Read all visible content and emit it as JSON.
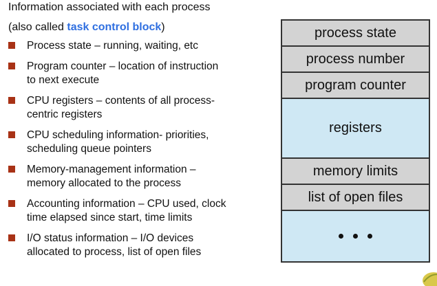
{
  "intro": {
    "line1": "Information associated with each process",
    "line2_prefix": "(also called ",
    "line2_highlight": "task control block",
    "line2_suffix": ")"
  },
  "bullets": [
    {
      "line1": "Process state – running, waiting, etc",
      "line2": ""
    },
    {
      "line1": "Program counter – location of instruction",
      "line2": "to next execute"
    },
    {
      "line1": "CPU registers – contents of all process-",
      "line2": "centric registers"
    },
    {
      "line1": "CPU scheduling information- priorities,",
      "line2": "scheduling queue pointers"
    },
    {
      "line1": "Memory-management information –",
      "line2": "memory allocated to the process"
    },
    {
      "line1": "Accounting information – CPU used, clock",
      "line2": "time elapsed since start, time limits"
    },
    {
      "line1": "I/O status information – I/O devices",
      "line2": "allocated to process, list of open files"
    }
  ],
  "pcb": {
    "fields": [
      "process state",
      "process number",
      "program counter",
      "registers",
      "memory limits",
      "list of open files"
    ]
  },
  "colors": {
    "highlight": "#2f6fe0",
    "bullet": "#a83216",
    "gray_cell": "#d3d3d3",
    "blue_cell": "#cfe8f4"
  }
}
